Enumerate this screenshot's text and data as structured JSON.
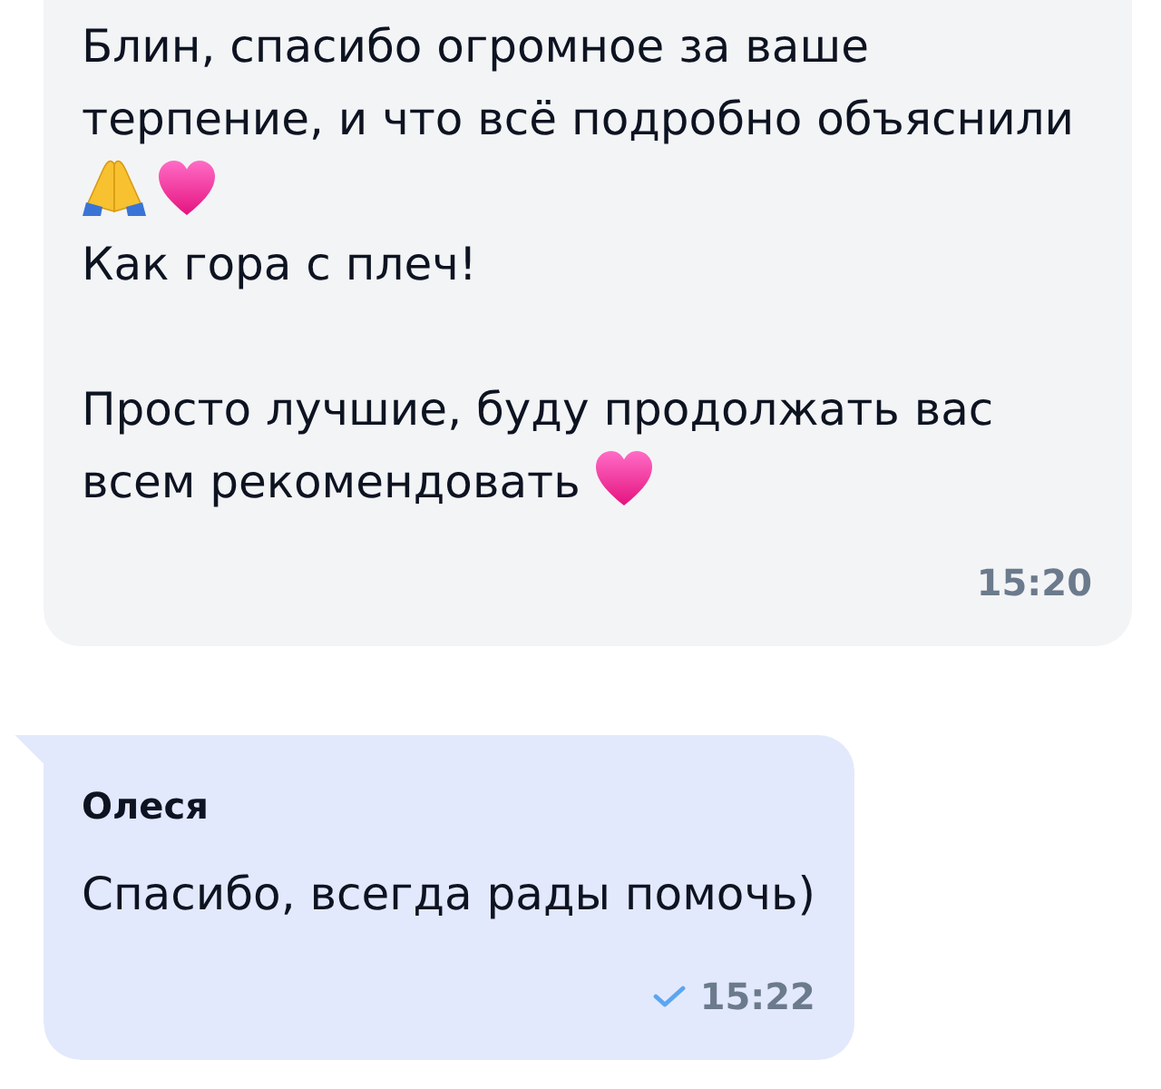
{
  "messages": [
    {
      "kind": "received",
      "paragraphs": [
        {
          "lines": [
            {
              "parts": [
                {
                  "kind": "text",
                  "text": "Блин, спасибо огромное за ваше терпение, и что всё подробно объяснили"
                }
              ]
            },
            {
              "parts": [
                {
                  "kind": "pray"
                },
                {
                  "kind": "heart"
                }
              ]
            },
            {
              "parts": [
                {
                  "kind": "text",
                  "text": "Как гора с плеч!"
                }
              ]
            }
          ]
        },
        {
          "lines": [
            {
              "parts": [
                {
                  "kind": "text",
                  "text": "Просто лучшие, буду продолжать вас"
                }
              ]
            },
            {
              "parts": [
                {
                  "kind": "text",
                  "text": "всем рекомендовать"
                },
                {
                  "kind": "heart"
                }
              ]
            }
          ]
        }
      ],
      "time": "15:20",
      "sent": false
    },
    {
      "kind": "reply",
      "sender": "Олеся",
      "paragraphs": [
        {
          "lines": [
            {
              "parts": [
                {
                  "kind": "text",
                  "text": "Спасибо, всегда рады помочь)"
                }
              ]
            }
          ]
        }
      ],
      "time": "15:22",
      "sent": true
    }
  ]
}
